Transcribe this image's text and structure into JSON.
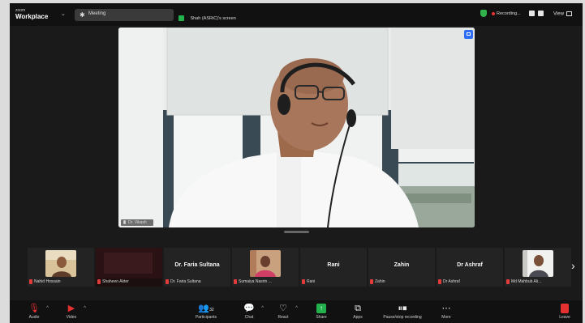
{
  "brand": {
    "top": "zoom",
    "main": "Workplace"
  },
  "topbar": {
    "meeting_label": "Meeting",
    "share_status": "Shah (ASRiC)'s screen",
    "recording_label": "Recording...",
    "view_label": "View"
  },
  "main_video": {
    "speaker_name": "Dr. Vikash"
  },
  "participants": [
    {
      "name": "Nahid Hossain",
      "mic_muted": true,
      "video": true
    },
    {
      "name": "Shaheen Akter",
      "mic_muted": true,
      "video": true
    },
    {
      "name": "Dr. Faria Sultana",
      "display": "Dr. Faria Sultana",
      "mic_muted": true,
      "video": false
    },
    {
      "name": "Sumaiya Nasrin ...",
      "mic_muted": true,
      "video": true
    },
    {
      "name": "Rani",
      "display": "Rani",
      "mic_muted": true,
      "video": false
    },
    {
      "name": "Zahin",
      "display": "Zahin",
      "mic_muted": true,
      "video": false
    },
    {
      "name": "Dr Ashraf",
      "display": "Dr Ashraf",
      "mic_muted": true,
      "video": false
    },
    {
      "name": "Md Mahbub Ali...",
      "mic_muted": true,
      "video": true
    }
  ],
  "toolbar": {
    "audio": "Audio",
    "video": "Video",
    "participants": "Participants",
    "participants_count": "32",
    "chat": "Chat",
    "react": "React",
    "share": "Share",
    "apps": "Apps",
    "recording": "Pause/stop recording",
    "more": "More",
    "leave": "Leave"
  },
  "colors": {
    "window_bg": "#1a1a1a",
    "bar_bg": "#111111",
    "share_green": "#23b14d",
    "muted_red": "#e53030",
    "pin_blue": "#2d6df6"
  },
  "icons": {
    "meeting": "meeting-icon",
    "share": "share-screen-icon",
    "security": "shield-icon",
    "view": "grid-view-icon"
  }
}
